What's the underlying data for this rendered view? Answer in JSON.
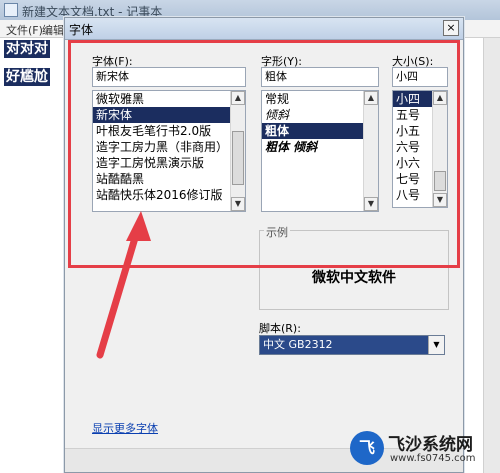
{
  "notepad": {
    "title": "新建文本文档.txt - 记事本",
    "menu": {
      "file": "文件(F)",
      "edit": "编辑"
    },
    "lines": [
      "对对对",
      "好尴尬"
    ]
  },
  "dialog": {
    "title": "字体",
    "close_label": "×",
    "font": {
      "label": "字体(F):",
      "value": "新宋体",
      "items": [
        "微软雅黑",
        "新宋体",
        "叶根友毛笔行书2.0版",
        "造字工房力黑（非商用）",
        "造字工房悦黑演示版",
        "站酷酷黑",
        "站酷快乐体2016修订版"
      ],
      "selected_index": 1
    },
    "style": {
      "label": "字形(Y):",
      "value": "粗体",
      "items": [
        "常规",
        "倾斜",
        "粗体",
        "粗体 倾斜"
      ],
      "selected_index": 2
    },
    "size": {
      "label": "大小(S):",
      "value": "小四",
      "items": [
        "小四",
        "五号",
        "小五",
        "六号",
        "小六",
        "七号",
        "八号"
      ],
      "selected_index": 0
    },
    "sample": {
      "label": "示例",
      "text": "微软中文软件"
    },
    "script": {
      "label": "脚本(R):",
      "value": "中文 GB2312"
    },
    "more_fonts_link": "显示更多字体"
  },
  "annotation": {
    "box_color": "#e53e47",
    "arrow_color": "#e53e47"
  },
  "watermark": {
    "logo_text": "飞",
    "title": "飞沙系统网",
    "url": "www.fs0745.com"
  },
  "colors": {
    "selection": "#1b2d5f",
    "link": "#0a3fb0"
  }
}
